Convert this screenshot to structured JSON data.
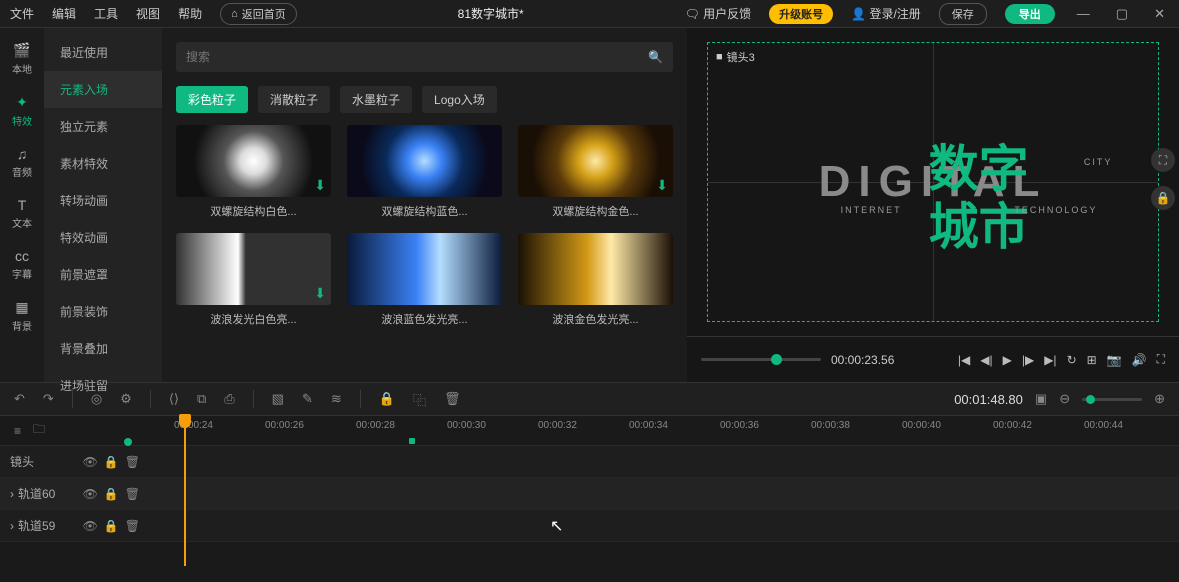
{
  "topbar": {
    "menus": [
      "文件",
      "编辑",
      "工具",
      "视图",
      "帮助"
    ],
    "return_home": "返回首页",
    "title": "81数字城市*",
    "feedback": "用户反馈",
    "upgrade": "升级账号",
    "login": "登录/注册",
    "save": "保存",
    "export": "导出"
  },
  "leftnav": [
    {
      "icon": "🎬",
      "label": "本地"
    },
    {
      "icon": "✦",
      "label": "特效"
    },
    {
      "icon": "♫",
      "label": "音频"
    },
    {
      "icon": "T",
      "label": "文本"
    },
    {
      "icon": "cc",
      "label": "字幕"
    },
    {
      "icon": "▦",
      "label": "背景"
    }
  ],
  "categories": [
    "最近使用",
    "元素入场",
    "独立元素",
    "素材特效",
    "转场动画",
    "特效动画",
    "前景遮罩",
    "前景装饰",
    "背景叠加",
    "进场驻留"
  ],
  "active_category": "元素入场",
  "search_placeholder": "搜索",
  "tabs": [
    "彩色粒子",
    "消散粒子",
    "水墨粒子",
    "Logo入场"
  ],
  "active_tab": "彩色粒子",
  "thumbs": [
    {
      "cap": "双螺旋结构白色...",
      "cls": "white",
      "dl": true
    },
    {
      "cap": "双螺旋结构蓝色...",
      "cls": "blue",
      "dl": false
    },
    {
      "cap": "双螺旋结构金色...",
      "cls": "gold",
      "dl": true
    },
    {
      "cap": "波浪发光白色亮...",
      "cls": "lwhite",
      "dl": true
    },
    {
      "cap": "波浪蓝色发光亮...",
      "cls": "lblue",
      "dl": false
    },
    {
      "cap": "波浪金色发光亮...",
      "cls": "lgold",
      "dl": false
    }
  ],
  "preview": {
    "shot_label": "镜头3",
    "en": "DIGITAL",
    "cn1": "数字",
    "cn2": "城市",
    "sub1": "INTERNET",
    "sub2": "CITY",
    "sub3": "TECHNOLOGY",
    "timecode": "00:00:23.56"
  },
  "toolbar": {
    "timecode": "00:01:48.80"
  },
  "timeline": {
    "ticks": [
      "00:00:24",
      "00:00:26",
      "00:00:28",
      "00:00:30",
      "00:00:32",
      "00:00:34",
      "00:00:36",
      "00:00:38",
      "00:00:40",
      "00:00:42",
      "00:00:44"
    ],
    "tracks": [
      {
        "name": "镜头"
      },
      {
        "name": "轨道60",
        "expand": true
      },
      {
        "name": "轨道59",
        "expand": true
      }
    ]
  }
}
